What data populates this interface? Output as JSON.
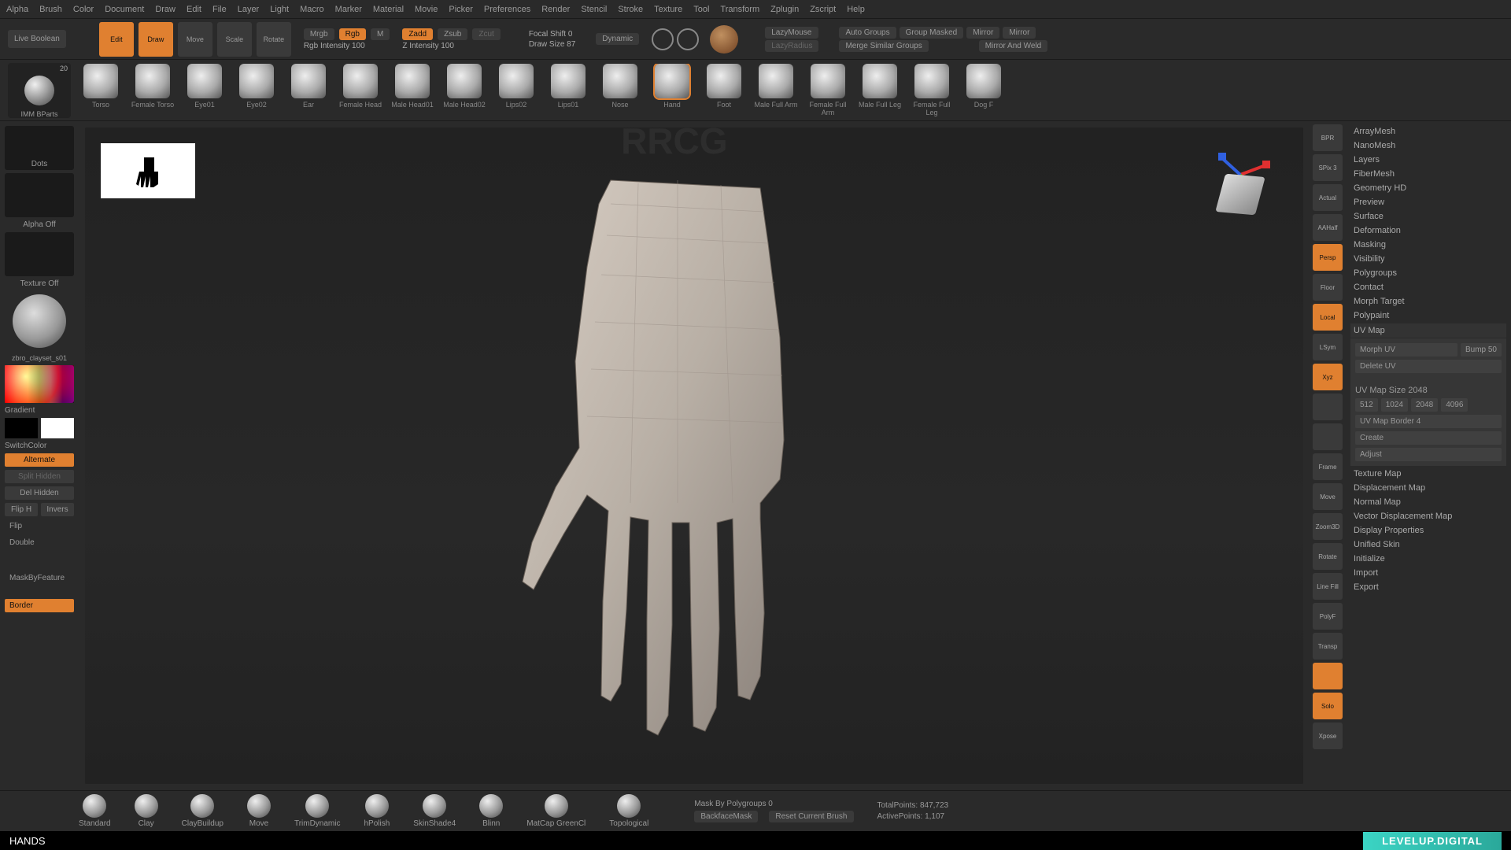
{
  "menu": [
    "Alpha",
    "Brush",
    "Color",
    "Document",
    "Draw",
    "Edit",
    "File",
    "Layer",
    "Light",
    "Macro",
    "Marker",
    "Material",
    "Movie",
    "Picker",
    "Preferences",
    "Render",
    "Stencil",
    "Stroke",
    "Texture",
    "Tool",
    "Transform",
    "Zplugin",
    "Zscript",
    "Help"
  ],
  "row2": {
    "live_boolean": "Live Boolean",
    "edit": "Edit",
    "draw": "Draw",
    "move": "Move",
    "scale": "Scale",
    "rotate": "Rotate",
    "mrgb": "Mrgb",
    "rgb": "Rgb",
    "m": "M",
    "rgb_int": "Rgb Intensity 100",
    "zadd": "Zadd",
    "zsub": "Zsub",
    "zcut": "Zcut",
    "z_int": "Z Intensity 100",
    "focal": "Focal Shift 0",
    "draw_size": "Draw Size 87",
    "dynamic": "Dynamic",
    "lazymouse": "LazyMouse",
    "lazyradius": "LazyRadius",
    "auto_groups": "Auto Groups",
    "group_masked": "Group Masked",
    "mirror": "Mirror",
    "mirror2": "Mirror",
    "merge_similar": "Merge Similar Groups",
    "mirror_weld": "Mirror And Weld"
  },
  "imm": {
    "label": "IMM BParts",
    "count": "20"
  },
  "brush_strip": [
    "Torso",
    "Female Torso",
    "Eye01",
    "Eye02",
    "Ear",
    "Female Head",
    "Male Head01",
    "Male Head02",
    "Lips02",
    "Lips01",
    "Nose",
    "Hand",
    "Foot",
    "Male Full Arm",
    "Female Full Arm",
    "Male Full Leg",
    "Female Full Leg",
    "Dog F"
  ],
  "brush_active": 11,
  "left": {
    "dots": "Dots",
    "alpha_off": "Alpha Off",
    "texture_off": "Texture Off",
    "material": "zbro_clayset_s01",
    "gradient": "Gradient",
    "switch": "SwitchColor",
    "alternate": "Alternate",
    "split_hidden": "Split Hidden",
    "del_hidden": "Del Hidden",
    "flip_h": "Flip H",
    "invert": "Invers",
    "flip": "Flip",
    "double": "Double",
    "mask_feature": "MaskByFeature",
    "border": "Border"
  },
  "right_strip": [
    {
      "l": "BPR"
    },
    {
      "l": "SPix 3"
    },
    {
      "l": "Actual"
    },
    {
      "l": "AAHalf"
    },
    {
      "l": "Persp",
      "o": true
    },
    {
      "l": "Floor"
    },
    {
      "l": "Local",
      "o": true
    },
    {
      "l": "LSym"
    },
    {
      "l": "Xyz",
      "o": true
    },
    {
      "l": ""
    },
    {
      "l": ""
    },
    {
      "l": "Frame"
    },
    {
      "l": "Move"
    },
    {
      "l": "Zoom3D"
    },
    {
      "l": "Rotate"
    },
    {
      "l": "Line Fill"
    },
    {
      "l": "PolyF"
    },
    {
      "l": "Transp"
    },
    {
      "l": "",
      "o": true
    },
    {
      "l": "Solo",
      "o": true
    },
    {
      "l": "Xpose"
    }
  ],
  "panel": {
    "items": [
      "ArrayMesh",
      "NanoMesh",
      "Layers",
      "FiberMesh",
      "Geometry HD",
      "Preview",
      "Surface",
      "Deformation",
      "Masking",
      "Visibility",
      "Polygroups",
      "Contact",
      "Morph Target",
      "Polypaint",
      "UV Map"
    ],
    "uv": {
      "morph": "Morph UV",
      "bump": "Bump 50",
      "delete": "Delete UV",
      "size_lbl": "UV Map Size 2048",
      "sizes": [
        "512",
        "1024",
        "2048",
        "4096"
      ],
      "border": "UV Map Border 4",
      "create": "Create",
      "adjust": "Adjust"
    },
    "items2": [
      "Texture Map",
      "Displacement Map",
      "Normal Map",
      "Vector Displacement Map",
      "Display Properties",
      "Unified Skin",
      "Initialize",
      "Import",
      "Export"
    ]
  },
  "bottom_brushes": [
    "Standard",
    "Clay",
    "ClayBuildup",
    "Move",
    "TrimDynamic",
    "hPolish",
    "SkinShade4",
    "Blinn",
    "MatCap GreenCl",
    "Topological"
  ],
  "status": {
    "mask_poly": "Mask By Polygroups 0",
    "backface": "BackfaceMask",
    "reset": "Reset Current Brush",
    "total": "TotalPoints: 847,723",
    "active": "ActivePoints: 1,107"
  },
  "footer": {
    "title": "HANDS",
    "brand": "LEVELUP.DIGITAL"
  },
  "watermark_big": "RRCG"
}
